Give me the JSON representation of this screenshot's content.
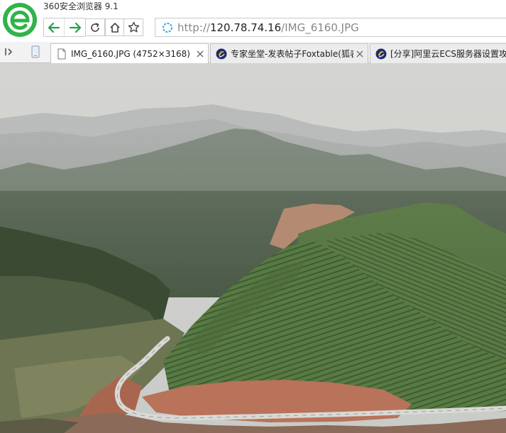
{
  "window": {
    "title": "360安全浏览器 9.1"
  },
  "toolbar": {
    "back": "back-arrow-icon",
    "forward": "forward-arrow-icon",
    "refresh": "refresh-icon",
    "home": "home-icon",
    "favorite": "star-icon"
  },
  "address": {
    "scheme": "http://",
    "host": "120.78.74.16",
    "path": "/IMG_6160.JPG"
  },
  "tabs": [
    {
      "label": "IMG_6160.JPG (4752×3168)",
      "active": true,
      "icon": "file-icon"
    },
    {
      "label": "专家坐堂-发表帖子Foxtable(狐表",
      "active": false,
      "icon": "forum-icon"
    },
    {
      "label": "[分享]阿里云ECS服务器设置攻略",
      "active": false,
      "icon": "forum-icon"
    }
  ],
  "colors": {
    "brand_green": "#2fb34a",
    "nav_green": "#22a04b",
    "sky": "#d3d3d0",
    "mountain_far": "#9aa1a0",
    "mountain_mid": "#4f5d4f",
    "tea_terrace": "#5b7a45",
    "soil": "#b8735a",
    "road": "#d9d9d6"
  }
}
